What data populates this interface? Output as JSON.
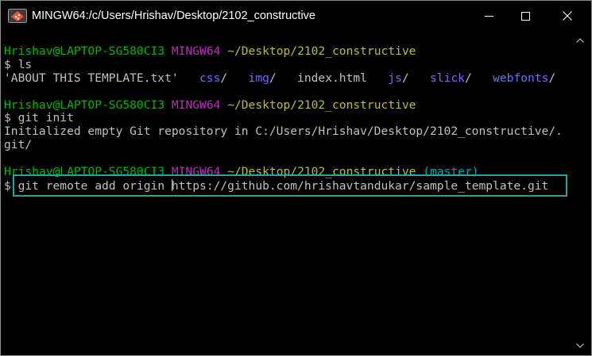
{
  "window": {
    "title": "MINGW64:/c/Users/Hrishav/Desktop/2102_constructive",
    "icon": "git-bash-icon",
    "controls": {
      "minimize": "minimize-icon",
      "maximize": "maximize-icon",
      "close": "close-icon"
    }
  },
  "colors": {
    "background": "#000000",
    "text": "#c0c0c0",
    "user_host": "#00ba00",
    "mingw": "#bc2fbc",
    "path": "#bfbc3a",
    "directory": "#6e6eff",
    "branch": "#00a3b3",
    "highlight": "#26a69a"
  },
  "terminal": {
    "prompt1": {
      "user_host": "Hrishav@LAPTOP-SG580CI3",
      "system": "MINGW64",
      "path": "~/Desktop/2102_constructive"
    },
    "prompt_symbol": "$",
    "cmd1": "ls",
    "ls_output": {
      "file1": "'ABOUT THIS TEMPLATE.txt'",
      "dir_css": "css",
      "dir_img": "img",
      "file2": "index.html",
      "dir_js": "js",
      "dir_slick": "slick",
      "dir_webfonts": "webfonts",
      "slash": "/"
    },
    "prompt2": {
      "user_host": "Hrishav@LAPTOP-SG580CI3",
      "system": "MINGW64",
      "path": "~/Desktop/2102_constructive"
    },
    "cmd2": "git init",
    "init_output_line1": "Initialized empty Git repository in C:/Users/Hrishav/Desktop/2102_constructive/.",
    "init_output_line2": "git/",
    "prompt3": {
      "user_host": "Hrishav@LAPTOP-SG580CI3",
      "system": "MINGW64",
      "path": "~/Desktop/2102_constructive",
      "branch": "(master)"
    },
    "cmd3_before_cursor": "git remote add origin ",
    "cmd3_after_cursor": "https://github.com/hrishavtandukar/sample_template.git"
  }
}
